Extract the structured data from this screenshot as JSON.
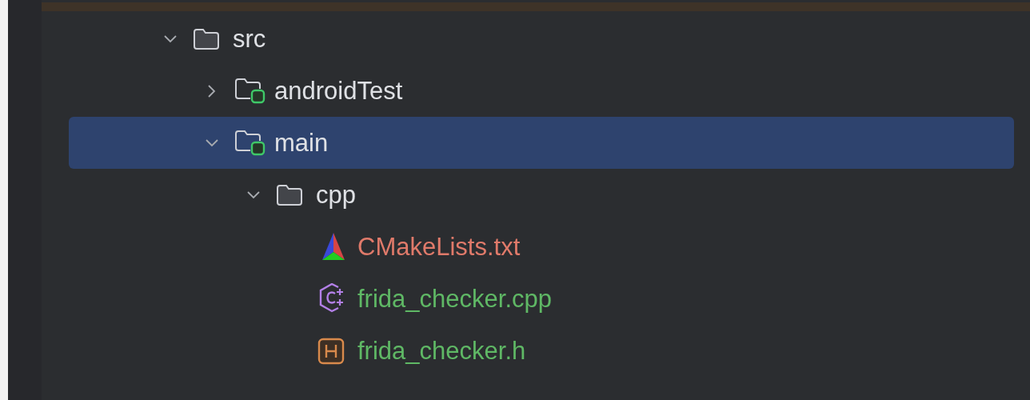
{
  "tree": [
    {
      "kind": "folder",
      "name": "src",
      "expanded": true,
      "selected": false,
      "children": [
        {
          "kind": "source-folder",
          "name": "androidTest",
          "expanded": false,
          "selected": false
        },
        {
          "kind": "source-folder",
          "name": "main",
          "expanded": true,
          "selected": true,
          "children": [
            {
              "kind": "folder",
              "name": "cpp",
              "expanded": true,
              "selected": false,
              "children": [
                {
                  "kind": "cmake",
                  "name": "CMakeLists.txt",
                  "color": "#e07a6a",
                  "selected": false
                },
                {
                  "kind": "cpp",
                  "name": "frida_checker.cpp",
                  "color": "#5fb865",
                  "selected": false
                },
                {
                  "kind": "header",
                  "name": "frida_checker.h",
                  "color": "#5fb865",
                  "selected": false
                }
              ]
            }
          ]
        }
      ]
    }
  ]
}
